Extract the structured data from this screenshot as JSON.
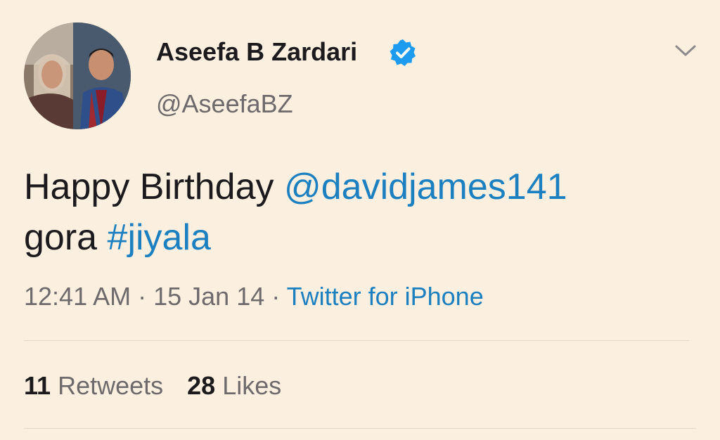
{
  "author": {
    "display_name": "Aseefa B Zardari",
    "handle": "@AseefaBZ",
    "verified": true
  },
  "icons": {
    "verified": "verified-badge-icon",
    "menu": "chevron-down-icon",
    "avatar": "profile-photo"
  },
  "tweet": {
    "text_prefix": "Happy Birthday ",
    "mention": "@davidjames141",
    "text_middle": "gora ",
    "hashtag": "#jiyala"
  },
  "meta": {
    "time": "12:41 AM",
    "separator": " · ",
    "date": "15 Jan 14",
    "source": "Twitter for iPhone"
  },
  "stats": {
    "retweets_count": "11",
    "retweets_label": "Retweets",
    "likes_count": "28",
    "likes_label": "Likes"
  },
  "colors": {
    "background": "#fbefe0",
    "link": "#1b7fc0",
    "verified": "#1d9bf0",
    "text": "#1c1a1d",
    "muted": "#6e6a6c"
  }
}
